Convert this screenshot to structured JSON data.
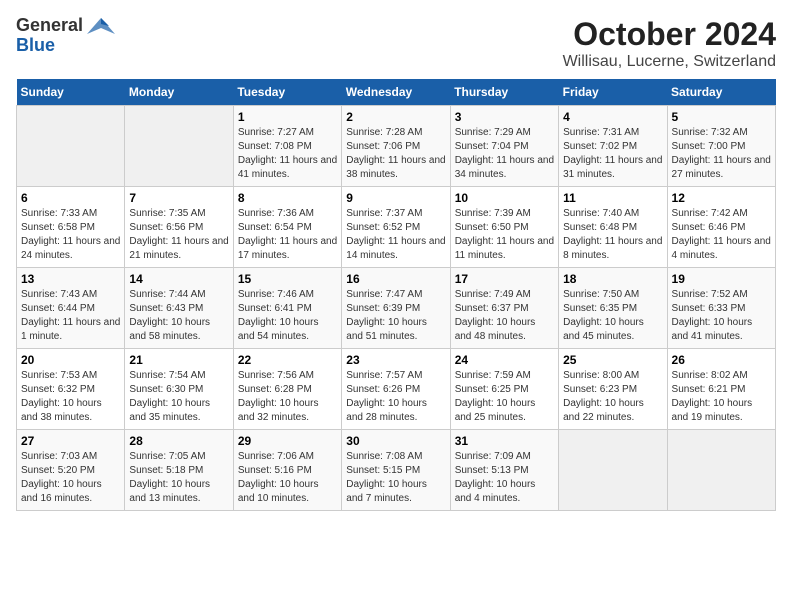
{
  "header": {
    "logo_general": "General",
    "logo_blue": "Blue",
    "title": "October 2024",
    "subtitle": "Willisau, Lucerne, Switzerland"
  },
  "weekdays": [
    "Sunday",
    "Monday",
    "Tuesday",
    "Wednesday",
    "Thursday",
    "Friday",
    "Saturday"
  ],
  "weeks": [
    [
      {
        "day": "",
        "empty": true
      },
      {
        "day": "",
        "empty": true
      },
      {
        "day": "1",
        "sunrise": "Sunrise: 7:27 AM",
        "sunset": "Sunset: 7:08 PM",
        "daylight": "Daylight: 11 hours and 41 minutes."
      },
      {
        "day": "2",
        "sunrise": "Sunrise: 7:28 AM",
        "sunset": "Sunset: 7:06 PM",
        "daylight": "Daylight: 11 hours and 38 minutes."
      },
      {
        "day": "3",
        "sunrise": "Sunrise: 7:29 AM",
        "sunset": "Sunset: 7:04 PM",
        "daylight": "Daylight: 11 hours and 34 minutes."
      },
      {
        "day": "4",
        "sunrise": "Sunrise: 7:31 AM",
        "sunset": "Sunset: 7:02 PM",
        "daylight": "Daylight: 11 hours and 31 minutes."
      },
      {
        "day": "5",
        "sunrise": "Sunrise: 7:32 AM",
        "sunset": "Sunset: 7:00 PM",
        "daylight": "Daylight: 11 hours and 27 minutes."
      }
    ],
    [
      {
        "day": "6",
        "sunrise": "Sunrise: 7:33 AM",
        "sunset": "Sunset: 6:58 PM",
        "daylight": "Daylight: 11 hours and 24 minutes."
      },
      {
        "day": "7",
        "sunrise": "Sunrise: 7:35 AM",
        "sunset": "Sunset: 6:56 PM",
        "daylight": "Daylight: 11 hours and 21 minutes."
      },
      {
        "day": "8",
        "sunrise": "Sunrise: 7:36 AM",
        "sunset": "Sunset: 6:54 PM",
        "daylight": "Daylight: 11 hours and 17 minutes."
      },
      {
        "day": "9",
        "sunrise": "Sunrise: 7:37 AM",
        "sunset": "Sunset: 6:52 PM",
        "daylight": "Daylight: 11 hours and 14 minutes."
      },
      {
        "day": "10",
        "sunrise": "Sunrise: 7:39 AM",
        "sunset": "Sunset: 6:50 PM",
        "daylight": "Daylight: 11 hours and 11 minutes."
      },
      {
        "day": "11",
        "sunrise": "Sunrise: 7:40 AM",
        "sunset": "Sunset: 6:48 PM",
        "daylight": "Daylight: 11 hours and 8 minutes."
      },
      {
        "day": "12",
        "sunrise": "Sunrise: 7:42 AM",
        "sunset": "Sunset: 6:46 PM",
        "daylight": "Daylight: 11 hours and 4 minutes."
      }
    ],
    [
      {
        "day": "13",
        "sunrise": "Sunrise: 7:43 AM",
        "sunset": "Sunset: 6:44 PM",
        "daylight": "Daylight: 11 hours and 1 minute."
      },
      {
        "day": "14",
        "sunrise": "Sunrise: 7:44 AM",
        "sunset": "Sunset: 6:43 PM",
        "daylight": "Daylight: 10 hours and 58 minutes."
      },
      {
        "day": "15",
        "sunrise": "Sunrise: 7:46 AM",
        "sunset": "Sunset: 6:41 PM",
        "daylight": "Daylight: 10 hours and 54 minutes."
      },
      {
        "day": "16",
        "sunrise": "Sunrise: 7:47 AM",
        "sunset": "Sunset: 6:39 PM",
        "daylight": "Daylight: 10 hours and 51 minutes."
      },
      {
        "day": "17",
        "sunrise": "Sunrise: 7:49 AM",
        "sunset": "Sunset: 6:37 PM",
        "daylight": "Daylight: 10 hours and 48 minutes."
      },
      {
        "day": "18",
        "sunrise": "Sunrise: 7:50 AM",
        "sunset": "Sunset: 6:35 PM",
        "daylight": "Daylight: 10 hours and 45 minutes."
      },
      {
        "day": "19",
        "sunrise": "Sunrise: 7:52 AM",
        "sunset": "Sunset: 6:33 PM",
        "daylight": "Daylight: 10 hours and 41 minutes."
      }
    ],
    [
      {
        "day": "20",
        "sunrise": "Sunrise: 7:53 AM",
        "sunset": "Sunset: 6:32 PM",
        "daylight": "Daylight: 10 hours and 38 minutes."
      },
      {
        "day": "21",
        "sunrise": "Sunrise: 7:54 AM",
        "sunset": "Sunset: 6:30 PM",
        "daylight": "Daylight: 10 hours and 35 minutes."
      },
      {
        "day": "22",
        "sunrise": "Sunrise: 7:56 AM",
        "sunset": "Sunset: 6:28 PM",
        "daylight": "Daylight: 10 hours and 32 minutes."
      },
      {
        "day": "23",
        "sunrise": "Sunrise: 7:57 AM",
        "sunset": "Sunset: 6:26 PM",
        "daylight": "Daylight: 10 hours and 28 minutes."
      },
      {
        "day": "24",
        "sunrise": "Sunrise: 7:59 AM",
        "sunset": "Sunset: 6:25 PM",
        "daylight": "Daylight: 10 hours and 25 minutes."
      },
      {
        "day": "25",
        "sunrise": "Sunrise: 8:00 AM",
        "sunset": "Sunset: 6:23 PM",
        "daylight": "Daylight: 10 hours and 22 minutes."
      },
      {
        "day": "26",
        "sunrise": "Sunrise: 8:02 AM",
        "sunset": "Sunset: 6:21 PM",
        "daylight": "Daylight: 10 hours and 19 minutes."
      }
    ],
    [
      {
        "day": "27",
        "sunrise": "Sunrise: 7:03 AM",
        "sunset": "Sunset: 5:20 PM",
        "daylight": "Daylight: 10 hours and 16 minutes."
      },
      {
        "day": "28",
        "sunrise": "Sunrise: 7:05 AM",
        "sunset": "Sunset: 5:18 PM",
        "daylight": "Daylight: 10 hours and 13 minutes."
      },
      {
        "day": "29",
        "sunrise": "Sunrise: 7:06 AM",
        "sunset": "Sunset: 5:16 PM",
        "daylight": "Daylight: 10 hours and 10 minutes."
      },
      {
        "day": "30",
        "sunrise": "Sunrise: 7:08 AM",
        "sunset": "Sunset: 5:15 PM",
        "daylight": "Daylight: 10 hours and 7 minutes."
      },
      {
        "day": "31",
        "sunrise": "Sunrise: 7:09 AM",
        "sunset": "Sunset: 5:13 PM",
        "daylight": "Daylight: 10 hours and 4 minutes."
      },
      {
        "day": "",
        "empty": true
      },
      {
        "day": "",
        "empty": true
      }
    ]
  ]
}
